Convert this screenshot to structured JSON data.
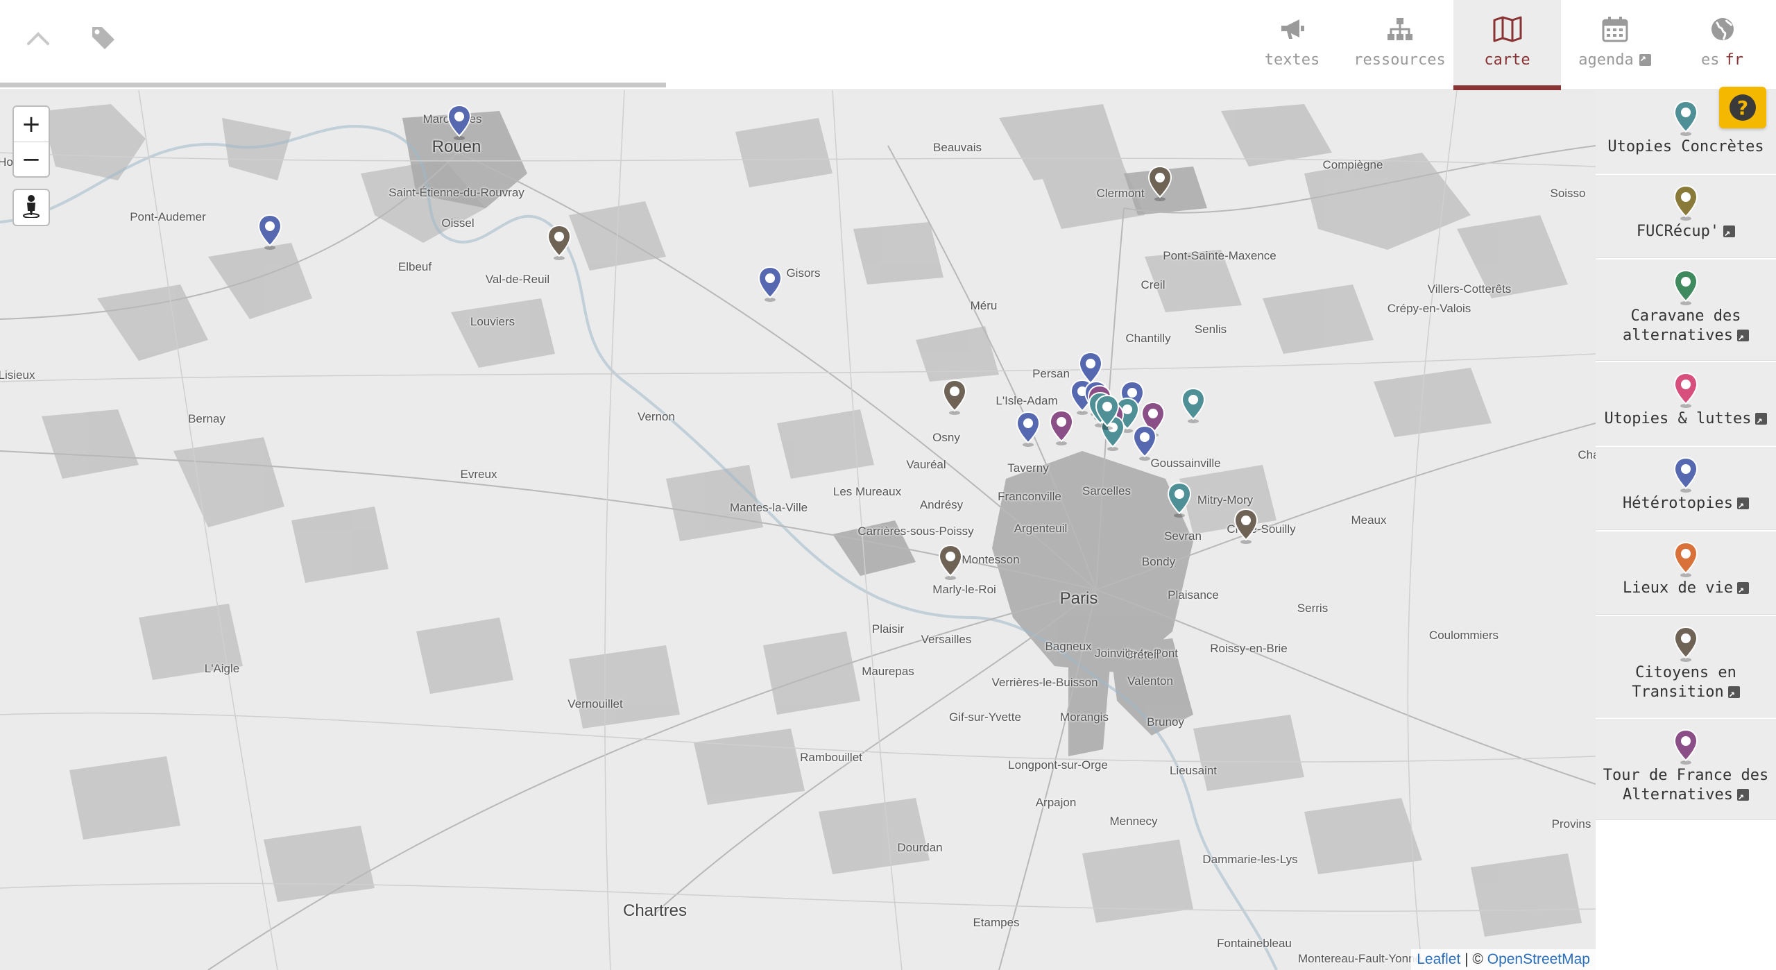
{
  "topbar": {
    "icons": {
      "back": "chevron-up-icon",
      "tags": "tag-icon"
    },
    "nav": [
      {
        "id": "textes",
        "label": "textes",
        "icon": "megaphone-icon",
        "active": false
      },
      {
        "id": "ressources",
        "label": "ressources",
        "icon": "sitemap-icon",
        "active": false
      },
      {
        "id": "carte",
        "label": "carte",
        "icon": "map-icon",
        "active": true
      },
      {
        "id": "agenda",
        "label": "agenda",
        "icon": "calendar-icon",
        "active": false,
        "external": true
      },
      {
        "id": "lang",
        "label_other": "es",
        "label_current": "fr",
        "icon": "globe-icon",
        "active": false
      }
    ],
    "accent_color": "#8a3335"
  },
  "map": {
    "controls": {
      "zoom_in": "+",
      "zoom_out": "−",
      "locate_icon": "person-icon"
    },
    "attribution": {
      "leaflet": "Leaflet",
      "separator": " | © ",
      "osm": "OpenStreetMap"
    },
    "places": [
      {
        "name": "Marommes"
      },
      {
        "name": "Rouen"
      },
      {
        "name": "Saint-Étienne-du-Rouvray"
      },
      {
        "name": "Oissel"
      },
      {
        "name": "Pont-Audemer"
      },
      {
        "name": "Elbeuf"
      },
      {
        "name": "Val-de-Reuil"
      },
      {
        "name": "Louviers"
      },
      {
        "name": "Lisieux"
      },
      {
        "name": "Bernay"
      },
      {
        "name": "Evreux"
      },
      {
        "name": "Vernon"
      },
      {
        "name": "Gisors"
      },
      {
        "name": "Beauvais"
      },
      {
        "name": "Clermont"
      },
      {
        "name": "Compiègne"
      },
      {
        "name": "Soisso"
      },
      {
        "name": "Pont-Sainte-Maxence"
      },
      {
        "name": "Creil"
      },
      {
        "name": "Villers-Cotterêts"
      },
      {
        "name": "Crépy-en-Valois"
      },
      {
        "name": "Senlis"
      },
      {
        "name": "Chantilly"
      },
      {
        "name": "Méru"
      },
      {
        "name": "Persan"
      },
      {
        "name": "L'Isle-Adam"
      },
      {
        "name": "Osny"
      },
      {
        "name": "Vauréal"
      },
      {
        "name": "Taverny"
      },
      {
        "name": "Goussainville"
      },
      {
        "name": "Sarcelles"
      },
      {
        "name": "Mitry-Mory"
      },
      {
        "name": "Claye-Souilly"
      },
      {
        "name": "Meaux"
      },
      {
        "name": "Mantes-la-Ville"
      },
      {
        "name": "Les Mureaux"
      },
      {
        "name": "Andrésy"
      },
      {
        "name": "Franconville"
      },
      {
        "name": "Argenteuil"
      },
      {
        "name": "Carrières-sous-Poissy"
      },
      {
        "name": "Montesson"
      },
      {
        "name": "Sevran"
      },
      {
        "name": "Bondy"
      },
      {
        "name": "Plaisance"
      },
      {
        "name": "Paris"
      },
      {
        "name": "Marly-le-Roi"
      },
      {
        "name": "Plaisir"
      },
      {
        "name": "Versailles"
      },
      {
        "name": "Bagneux"
      },
      {
        "name": "Joinville-le-Pont"
      },
      {
        "name": "Créteil"
      },
      {
        "name": "Roissy-en-Brie"
      },
      {
        "name": "Serris"
      },
      {
        "name": "Coulommiers"
      },
      {
        "name": "L'Aigle"
      },
      {
        "name": "Maurepas"
      },
      {
        "name": "Verrières-le-Buisson"
      },
      {
        "name": "Valenton"
      },
      {
        "name": "Vernouillet"
      },
      {
        "name": "Gif-sur-Yvette"
      },
      {
        "name": "Morangis"
      },
      {
        "name": "Brunoy"
      },
      {
        "name": "Rambouillet"
      },
      {
        "name": "Longpont-sur-Orge"
      },
      {
        "name": "Lieusaint"
      },
      {
        "name": "Arpajon"
      },
      {
        "name": "Mennecy"
      },
      {
        "name": "Provins"
      },
      {
        "name": "Dourdan"
      },
      {
        "name": "Dammarie-les-Lys"
      },
      {
        "name": "Chartres"
      },
      {
        "name": "Etampes"
      },
      {
        "name": "Fontainebleau"
      },
      {
        "name": "Montereau-Fault-Yonne"
      },
      {
        "name": "Cha"
      },
      {
        "name": "Ho"
      }
    ]
  },
  "legend": {
    "help_icon": "question-icon",
    "items": [
      {
        "label": "Utopies Concrètes",
        "color": "#4f8f96",
        "external": false
      },
      {
        "label": "FUCRécup'",
        "color": "#8a7a3a",
        "external": true
      },
      {
        "label": "Caravane des alternatives",
        "color": "#3f8a5e",
        "external": true
      },
      {
        "label": "Utopies & luttes",
        "color": "#d64f7d",
        "external": true
      },
      {
        "label": "Hétérotopies",
        "color": "#5668b0",
        "external": true
      },
      {
        "label": "Lieux de vie",
        "color": "#d9713a",
        "external": true
      },
      {
        "label": "Citoyens en Transition",
        "color": "#6f6356",
        "external": true
      },
      {
        "label": "Tour de France des Alternatives",
        "color": "#8a4f86",
        "external": true
      }
    ]
  }
}
